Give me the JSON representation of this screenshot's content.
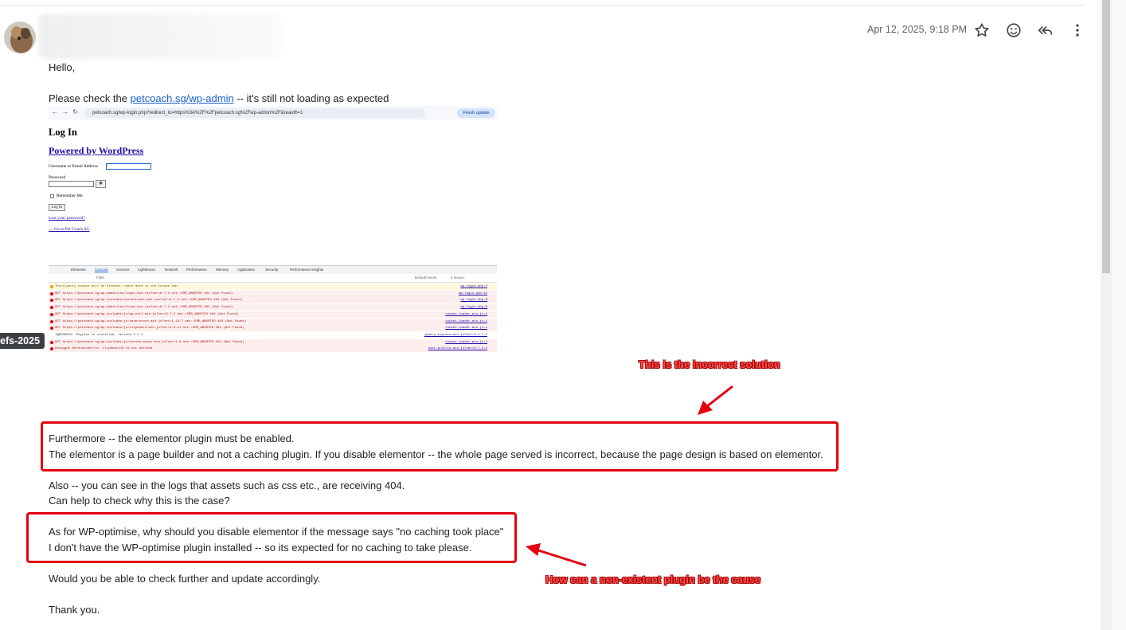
{
  "header": {
    "date": "Apr 12, 2025, 9:18 PM",
    "icons": [
      "star-icon",
      "emoji-icon",
      "reply-all-icon",
      "more-vert-icon"
    ]
  },
  "side_tag": "efs-2025",
  "body": {
    "greeting": "Hello,",
    "line1_pre": "Please check the ",
    "line1_link": "petcoach.sg/wp-admin",
    "line1_post": " -- it's still not loading as expected",
    "box1_line1": "Furthermore -- the elementor plugin must be enabled.",
    "box1_line2": "The elementor is a page builder and not a caching plugin. If you disable elementor -- the whole page served is incorrect, because the page design is based on elementor.",
    "para2_line1": "Also -- you can see in the logs that assets such as css etc., are receiving 404.",
    "para2_line2": "Can help to check why this is the case?",
    "box2_line1": "As for WP-optimise, why should you disable elementor if the message says \"no caching took place\"",
    "box2_line2": "I don't have the WP-optimise plugin installed -- so its expected for no caching to take please.",
    "para3": "Would you be able to check further and update accordingly.",
    "closing": "Thank you."
  },
  "annotations": {
    "note1": "This is the incorrect solution",
    "note2": "How can a non-existent plugin be the cause"
  },
  "screenshot": {
    "url": "petcoach.sg/wp-login.php?redirect_to=https%3A%2F%2Fpetcoach.sg%2Fwp-admin%2F&reauth=1",
    "finish_update": "Finish update",
    "login_title": "Log In",
    "powered_by": "Powered by WordPress",
    "username_label": "Username or Email Address",
    "password_label": "Password",
    "remember_me": "Remember Me",
    "login_button": "Log In",
    "lost_password": "Lost your password?",
    "go_to_site": "← Go to Pet Coach SG",
    "devtools_tabs": [
      "Elements",
      "Console",
      "Sources",
      "Lighthouse",
      "Network",
      "Performance",
      "Memory",
      "Application",
      "Security",
      "Performance insights"
    ],
    "devtools_filter_placeholder": "Filter",
    "devtools_levels": "Default levels",
    "devtools_issues": "4 Issues:",
    "console_rows": [
      {
        "msg": "Third-party cookie will be blocked. Learn more in the Issues tab.",
        "src": "wp-login.php:3",
        "type": "warn"
      },
      {
        "msg": "GET https://petcoach.sg/wp-admin/css/login.min.css?ver=6.7.2 net::ERR_ABORTED 404 (Not Found)",
        "src": "wp-login.php:11",
        "type": "error"
      },
      {
        "msg": "GET https://petcoach.sg/wp-includes/css/buttons.min.css?ver=6.7.2 net::ERR_ABORTED 404 (Not Found)",
        "src": "wp-login.php:8",
        "type": "error"
      },
      {
        "msg": "GET https://petcoach.sg/wp-admin/css/forms.min.css?ver=6.7.2 net::ERR_ABORTED 404 (Not Found)",
        "src": "wp-login.php:9",
        "type": "error"
      },
      {
        "msg": "GET https://petcoach.sg/wp-includes/js/wp-util.min.js?ver=6.7.2 net::ERR_ABORTED 404 (Not Found)",
        "src": "rocket-loader.min.js:1",
        "type": "error"
      },
      {
        "msg": "GET https://petcoach.sg/wp-includes/js/underscore.min.js?ver=1.13.7 net::ERR_ABORTED 404 (Not Found)",
        "src": "rocket-loader.min.js:1",
        "type": "error"
      },
      {
        "msg": "GET https://petcoach.sg/wp-includes/js/clipboard.min.js?ver=2.0.11 net::ERR_ABORTED 404 (Not Found)",
        "src": "rocket-loader.min.js:1",
        "type": "error"
      },
      {
        "msg": "JQMIGRATE: Migrate is installed, version 3.4.1",
        "src": "jquery-migrate.min.js?ver=3.4.1:2",
        "type": "info"
      },
      {
        "msg": "GET https://petcoach.sg/wp-includes/js/zxcvbn-async.min.js?ver=1.0 net::ERR_ABORTED 404 (Not Found)",
        "src": "rocket-loader.min.js:1",
        "type": "error"
      },
      {
        "msg": "Uncaught ReferenceError: ClipboardJS is not defined",
        "src": "user-profile.min.js?ver=6.7.2:2",
        "type": "error"
      }
    ]
  }
}
